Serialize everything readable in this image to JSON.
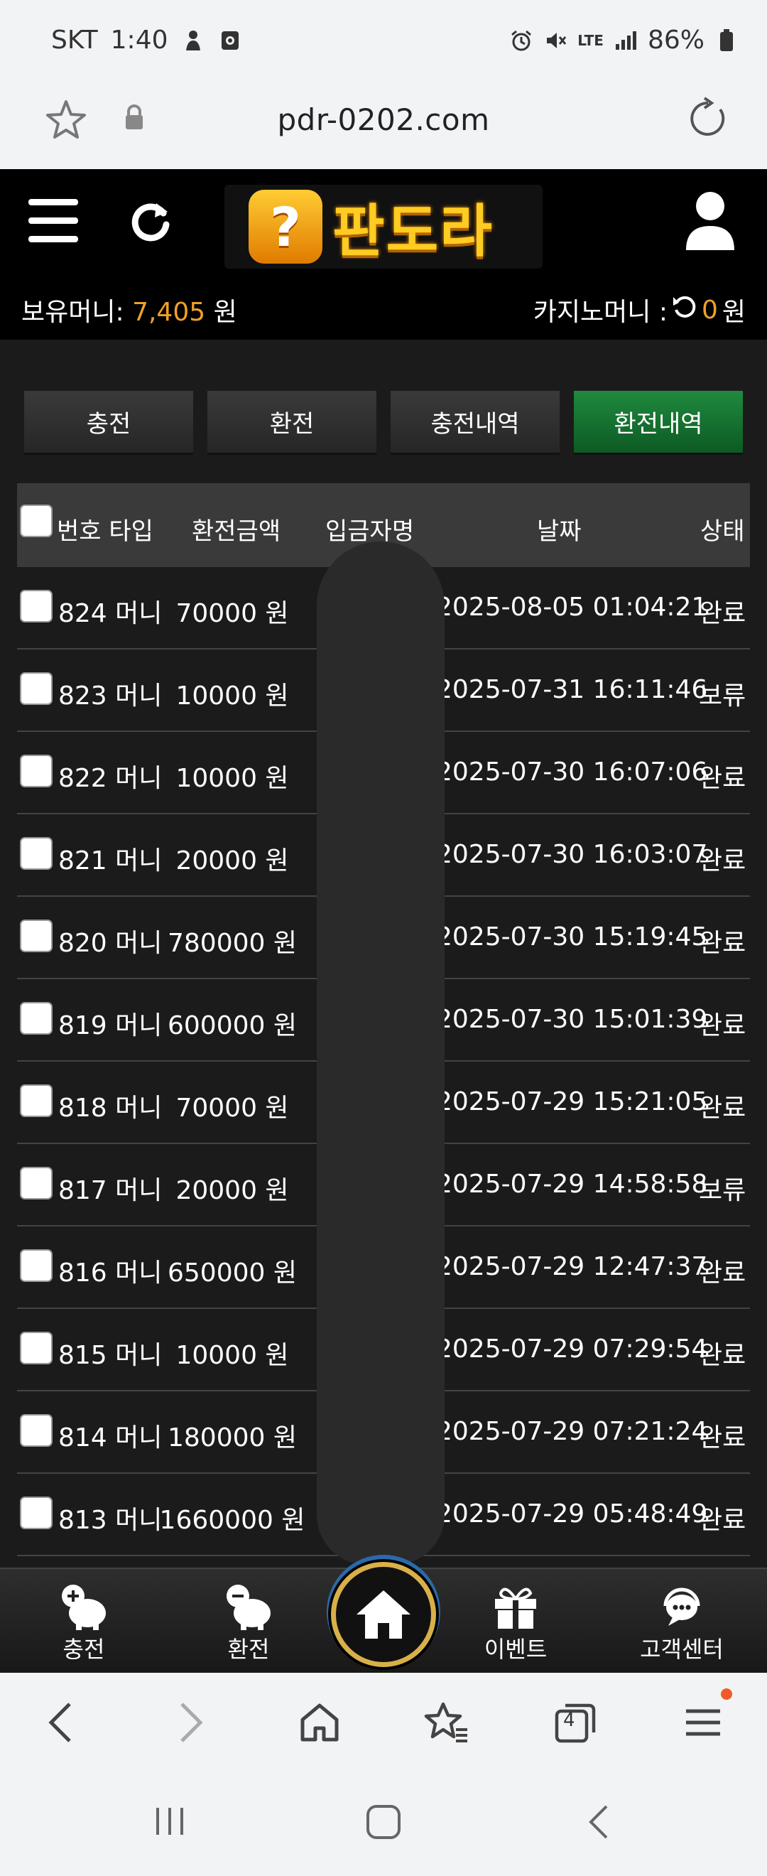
{
  "status_bar": {
    "carrier": "SKT",
    "time": "1:40",
    "network": "LTE",
    "battery": "86%"
  },
  "browser": {
    "url": "pdr-0202.com",
    "tab_count": "4"
  },
  "site": {
    "logo_text": "판도라",
    "logo_badge": "?",
    "money_label": "보유머니:",
    "money_value": "7,405",
    "money_unit": "원",
    "casino_label": "카지노머니 :",
    "casino_value": "0",
    "casino_unit": "원"
  },
  "tabs": [
    {
      "label": "충전",
      "active": false
    },
    {
      "label": "환전",
      "active": false
    },
    {
      "label": "충전내역",
      "active": false
    },
    {
      "label": "환전내역",
      "active": true
    }
  ],
  "table": {
    "headers": {
      "num_type": "번호 타입",
      "amount": "환전금액",
      "depositor": "입금자명",
      "date": "날짜",
      "status": "상태"
    },
    "rows": [
      {
        "num": "824",
        "type": "머니",
        "amount": "70000 원",
        "date": "2025-08-05 01:04:21",
        "status": "완료"
      },
      {
        "num": "823",
        "type": "머니",
        "amount": "10000 원",
        "date": "2025-07-31 16:11:46",
        "status": "보류"
      },
      {
        "num": "822",
        "type": "머니",
        "amount": "10000 원",
        "date": "2025-07-30 16:07:06",
        "status": "완료"
      },
      {
        "num": "821",
        "type": "머니",
        "amount": "20000 원",
        "date": "2025-07-30 16:03:07",
        "status": "완료"
      },
      {
        "num": "820",
        "type": "머니",
        "amount": "780000 원",
        "date": "2025-07-30 15:19:45",
        "status": "완료"
      },
      {
        "num": "819",
        "type": "머니",
        "amount": "600000 원",
        "date": "2025-07-30 15:01:39",
        "status": "완료"
      },
      {
        "num": "818",
        "type": "머니",
        "amount": "70000 원",
        "date": "2025-07-29 15:21:05",
        "status": "완료"
      },
      {
        "num": "817",
        "type": "머니",
        "amount": "20000 원",
        "date": "2025-07-29 14:58:58",
        "status": "보류"
      },
      {
        "num": "816",
        "type": "머니",
        "amount": "650000 원",
        "date": "2025-07-29 12:47:37",
        "status": "완료"
      },
      {
        "num": "815",
        "type": "머니",
        "amount": "10000 원",
        "date": "2025-07-29 07:29:54",
        "status": "완료"
      },
      {
        "num": "814",
        "type": "머니",
        "amount": "180000 원",
        "date": "2025-07-29 07:21:24",
        "status": "완료"
      },
      {
        "num": "813",
        "type": "머니",
        "amount": "1660000 원",
        "date": "2025-07-29 05:48:49",
        "status": "완료"
      }
    ]
  },
  "bottom_nav": {
    "charge": "충전",
    "exchange": "환전",
    "event": "이벤트",
    "support": "고객센터"
  },
  "colors": {
    "accent_orange": "#f0a028",
    "active_tab_green": "#1f8a3e",
    "logo_gold": "#ffcc22"
  }
}
